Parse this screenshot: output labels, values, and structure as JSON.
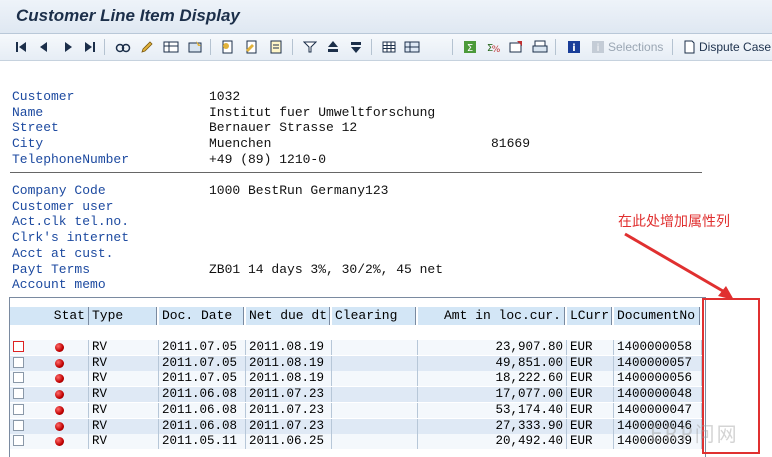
{
  "window": {
    "title": "Customer Line Item Display"
  },
  "toolbar": {
    "selections_label": "Selections",
    "dispute_case_label": "Dispute Case"
  },
  "header": {
    "fields": [
      {
        "label": "Customer",
        "value": "1032"
      },
      {
        "label": "Name",
        "value": "Institut fuer Umweltforschung"
      },
      {
        "label": "Street",
        "value": "Bernauer Strasse 12"
      },
      {
        "label": "City",
        "value": "Muenchen",
        "postal": "81669"
      },
      {
        "label": "TelephoneNumber",
        "value": "+49 (89) 1210-0"
      }
    ],
    "fields2": [
      {
        "label": "Company Code",
        "value": "1000 BestRun Germany123"
      },
      {
        "label": "Customer user",
        "value": ""
      },
      {
        "label": "Act.clk tel.no.",
        "value": ""
      },
      {
        "label": "Clrk's internet",
        "value": ""
      },
      {
        "label": "Acct at cust.",
        "value": ""
      },
      {
        "label": "Payt Terms",
        "value": "ZB01 14 days 3%, 30/2%, 45 net"
      },
      {
        "label": "Account memo",
        "value": ""
      }
    ]
  },
  "annotation": {
    "text": "在此处增加属性列"
  },
  "grid": {
    "columns": [
      "Stat",
      "Type",
      "Doc. Date",
      "Net due dt",
      "Clearing",
      "Amt in loc.cur.",
      "LCurr",
      "DocumentNo"
    ],
    "rows": [
      {
        "type": "RV",
        "doc_date": "2011.07.05",
        "net_due": "2011.08.19",
        "clearing": "",
        "amount": "23,907.80",
        "curr": "EUR",
        "doc_no": "1400000058"
      },
      {
        "type": "RV",
        "doc_date": "2011.07.05",
        "net_due": "2011.08.19",
        "clearing": "",
        "amount": "49,851.00",
        "curr": "EUR",
        "doc_no": "1400000057"
      },
      {
        "type": "RV",
        "doc_date": "2011.07.05",
        "net_due": "2011.08.19",
        "clearing": "",
        "amount": "18,222.60",
        "curr": "EUR",
        "doc_no": "1400000056"
      },
      {
        "type": "RV",
        "doc_date": "2011.06.08",
        "net_due": "2011.07.23",
        "clearing": "",
        "amount": "17,077.00",
        "curr": "EUR",
        "doc_no": "1400000048"
      },
      {
        "type": "RV",
        "doc_date": "2011.06.08",
        "net_due": "2011.07.23",
        "clearing": "",
        "amount": "53,174.40",
        "curr": "EUR",
        "doc_no": "1400000047"
      },
      {
        "type": "RV",
        "doc_date": "2011.06.08",
        "net_due": "2011.07.23",
        "clearing": "",
        "amount": "27,333.90",
        "curr": "EUR",
        "doc_no": "1400000046"
      },
      {
        "type": "RV",
        "doc_date": "2011.05.11",
        "net_due": "2011.06.25",
        "clearing": "",
        "amount": "20,492.40",
        "curr": "EUR",
        "doc_no": "1400000039"
      }
    ]
  },
  "icons": [
    "first-page-icon",
    "previous-page-icon",
    "next-page-icon",
    "last-page-icon",
    "find-icon",
    "edit-icon",
    "select-layout-icon",
    "change-layout-icon",
    "display-document-icon",
    "change-document-icon",
    "document-overview-icon",
    "filter-icon",
    "sort-ascending-icon",
    "sort-descending-icon",
    "spreadsheet-icon",
    "layout-grid-icon",
    "sum-icon",
    "subtotal-icon",
    "export-icon",
    "print-icon",
    "info-icon",
    "selections-icon",
    "dispute-case-icon"
  ],
  "colors": {
    "label_blue": "#1d4aa0",
    "header_bg": "#d3e6f6",
    "status_red": "#cc0000",
    "annotation_red": "#e03030"
  }
}
